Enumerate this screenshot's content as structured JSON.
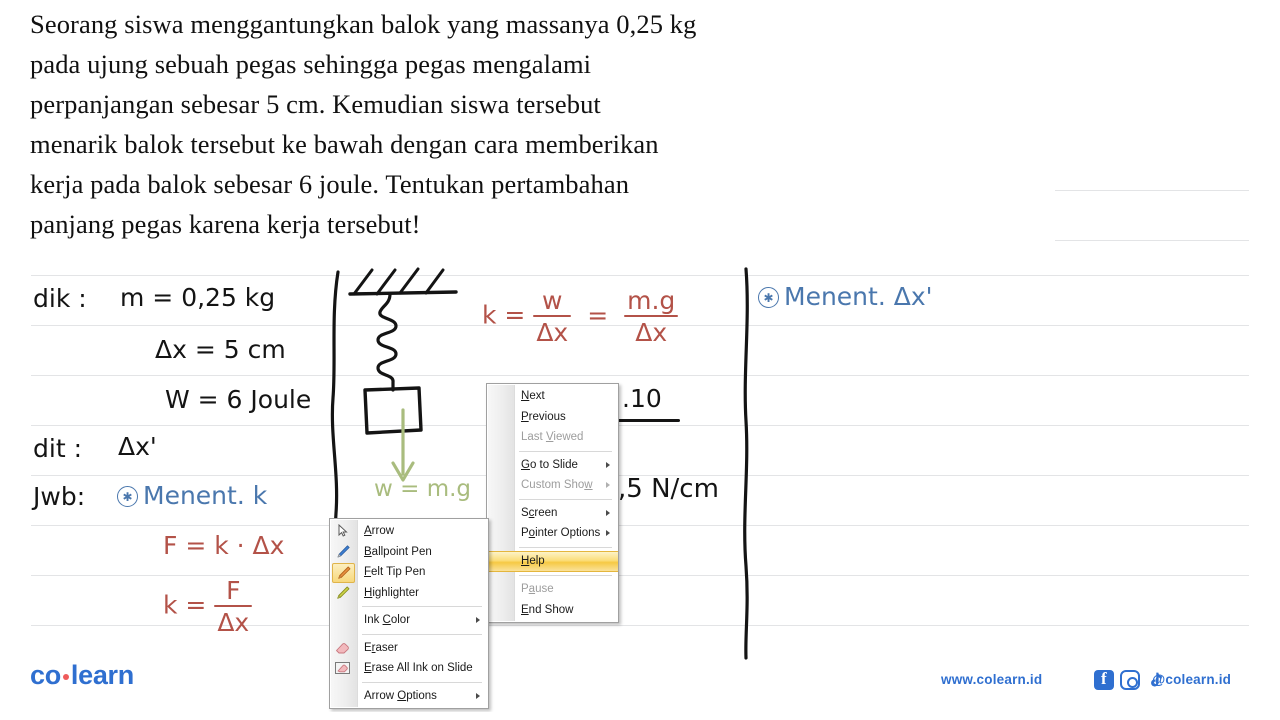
{
  "document": {
    "question_lines": [
      "Seorang siswa menggantungkan balok yang massanya 0,25 kg",
      "pada ujung sebuah pegas sehingga pegas mengalami",
      "perpanjangan sebesar 5 cm. Kemudian siswa tersebut",
      "menarik balok tersebut ke bawah dengan cara memberikan",
      "kerja pada balok sebesar 6 joule. Tentukan pertambahan",
      "panjang pegas karena kerja tersebut!"
    ]
  },
  "annotations": {
    "given_label": "dik :",
    "given_mass": "m = 0,25 kg",
    "given_dx": "Δx = 5 cm",
    "given_w": "W = 6 Joule",
    "asked_label": "dit :",
    "asked_value": "Δx'",
    "answer_label": "Jwb:",
    "step1_title": "Menent. k",
    "step1_eq1": "F = k · Δx",
    "step1_eq2_lhs": "k =",
    "step1_eq2_num": "F",
    "step1_eq2_den": "Δx",
    "spring_force_label": "w = m.g",
    "k_formula_lhs": "k =",
    "k_formula_eq": "=",
    "k_formula_num1": "w",
    "k_formula_den1": "Δx",
    "k_formula_num2": "m.g",
    "k_formula_den2": "Δx",
    "k_partial_top": ".10",
    "k_partial_result": ",5 N/cm",
    "step2_title": "Menent. Δx'",
    "colors": {
      "black": "#141414",
      "red": "#b35248",
      "blue": "#4a77ad",
      "green": "#a9bc7e"
    }
  },
  "context_menu": {
    "items": [
      {
        "label": "Next",
        "mnemonic": "N",
        "disabled": false,
        "submenu": false,
        "highlighted": false
      },
      {
        "label": "Previous",
        "mnemonic": "P",
        "disabled": false,
        "submenu": false,
        "highlighted": false
      },
      {
        "label": "Last Viewed",
        "mnemonic": "V",
        "disabled": true,
        "submenu": false,
        "highlighted": false
      },
      {
        "separator": true
      },
      {
        "label": "Go to Slide",
        "mnemonic": "G",
        "disabled": false,
        "submenu": true,
        "highlighted": false
      },
      {
        "label": "Custom Show",
        "mnemonic": "w",
        "disabled": true,
        "submenu": true,
        "highlighted": false
      },
      {
        "separator": true
      },
      {
        "label": "Screen",
        "mnemonic": "c",
        "disabled": false,
        "submenu": true,
        "highlighted": false
      },
      {
        "label": "Pointer Options",
        "mnemonic": "o",
        "disabled": false,
        "submenu": true,
        "highlighted": false
      },
      {
        "separator": true
      },
      {
        "label": "Help",
        "mnemonic": "H",
        "disabled": false,
        "submenu": false,
        "highlighted": true
      },
      {
        "separator": true
      },
      {
        "label": "Pause",
        "mnemonic": "a",
        "disabled": true,
        "submenu": false,
        "highlighted": false
      },
      {
        "label": "End Show",
        "mnemonic": "E",
        "disabled": false,
        "submenu": false,
        "highlighted": false
      }
    ]
  },
  "pointer_submenu": {
    "items": [
      {
        "label": "Arrow",
        "mnemonic": "A",
        "icon": "cursor-arrow-icon",
        "selected": false,
        "submenu": false,
        "disabled": false
      },
      {
        "label": "Ballpoint Pen",
        "mnemonic": "B",
        "icon": "ballpoint-pen-icon",
        "selected": false,
        "submenu": false,
        "disabled": false
      },
      {
        "label": "Felt Tip Pen",
        "mnemonic": "F",
        "icon": "felt-tip-pen-icon",
        "selected": true,
        "submenu": false,
        "disabled": false
      },
      {
        "label": "Highlighter",
        "mnemonic": "H",
        "icon": "highlighter-icon",
        "selected": false,
        "submenu": false,
        "disabled": false
      },
      {
        "separator": true
      },
      {
        "label": "Ink Color",
        "mnemonic": "C",
        "icon": "",
        "selected": false,
        "submenu": true,
        "disabled": false
      },
      {
        "separator": true
      },
      {
        "label": "Eraser",
        "mnemonic": "r",
        "icon": "eraser-icon",
        "selected": false,
        "submenu": false,
        "disabled": false
      },
      {
        "label": "Erase All Ink on Slide",
        "mnemonic": "E",
        "icon": "erase-all-ink-icon",
        "selected": false,
        "submenu": false,
        "disabled": false
      },
      {
        "separator": true
      },
      {
        "label": "Arrow Options",
        "mnemonic": "O",
        "icon": "",
        "selected": false,
        "submenu": true,
        "disabled": false
      }
    ]
  },
  "footer": {
    "logo_part1": "co",
    "logo_part2": "learn",
    "website": "www.colearn.id",
    "handle": "@colearn.id",
    "brand_color": "#2f6fd0"
  }
}
